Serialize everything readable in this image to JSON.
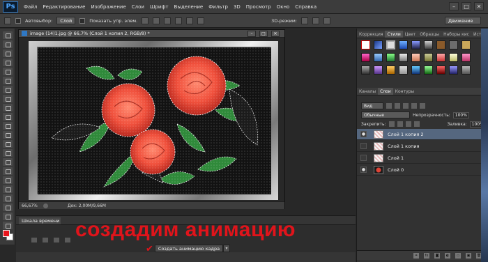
{
  "app": {
    "logo": "Ps"
  },
  "menu": [
    "Файл",
    "Редактирование",
    "Изображение",
    "Слои",
    "Шрифт",
    "Выделение",
    "Фильтр",
    "3D",
    "Просмотр",
    "Окно",
    "Справка"
  ],
  "window_controls": {
    "minimize": "–",
    "maximize": "□",
    "close": "✕"
  },
  "options": {
    "autoselect_label": "Автовыбор:",
    "autoselect_value": "Слой",
    "show_controls": "Показать упр. элем.",
    "mode_3d": "3D-режим:",
    "workspace": "Движение"
  },
  "document": {
    "title": "image (14)1.jpg @ 66,7% (Слой 1 копия 2, RGB/8) *",
    "zoom": "66,67%",
    "doc_size": "Док: 2,00M/9,66M",
    "ctrl_min": "–",
    "ctrl_max": "□",
    "ctrl_close": "✕"
  },
  "timeline": {
    "tab_label": "Шкала времени",
    "create_button": "Создать анимацию кадра",
    "dropdown_arrow": "▾",
    "checkmark": "✔",
    "annotation": "создадим анимацию"
  },
  "panels": {
    "top_tabs": [
      "Коррекция",
      "Стили",
      "Цвет",
      "Образцы",
      "Наборы кис",
      "История"
    ],
    "top_active": 1,
    "mid_tabs": [
      "Каналы",
      "Слои",
      "Контуры"
    ],
    "mid_active": 1,
    "kind_filter": "Вид",
    "blend_mode": "Обычные",
    "opacity_label": "Непрозрачность:",
    "opacity_value": "100%",
    "lock_label": "Закрепить:",
    "fill_label": "Заливка:",
    "fill_value": "100%"
  },
  "layers": [
    {
      "name": "Слой 1 копия 2",
      "visible": true,
      "selected": true,
      "thumb": "pattern"
    },
    {
      "name": "Слой 1 копия",
      "visible": false,
      "selected": false,
      "thumb": "pattern"
    },
    {
      "name": "Слой 1",
      "visible": false,
      "selected": false,
      "thumb": "pattern"
    },
    {
      "name": "Слой 0",
      "visible": true,
      "selected": false,
      "thumb": "rose"
    }
  ],
  "layer_bottom_icons": [
    "link-icon",
    "fx-icon",
    "mask-icon",
    "adjustment-icon",
    "group-icon",
    "new-layer-icon",
    "trash-icon"
  ],
  "layer_bottom_labels": [
    "⚭",
    "fx",
    "◙",
    "◐",
    "▭",
    "▣",
    "🗑"
  ],
  "colors": {
    "foreground": "#e8141b",
    "background": "#ffffff",
    "annotation": "#e0141b",
    "selected_layer": "#55677f"
  }
}
